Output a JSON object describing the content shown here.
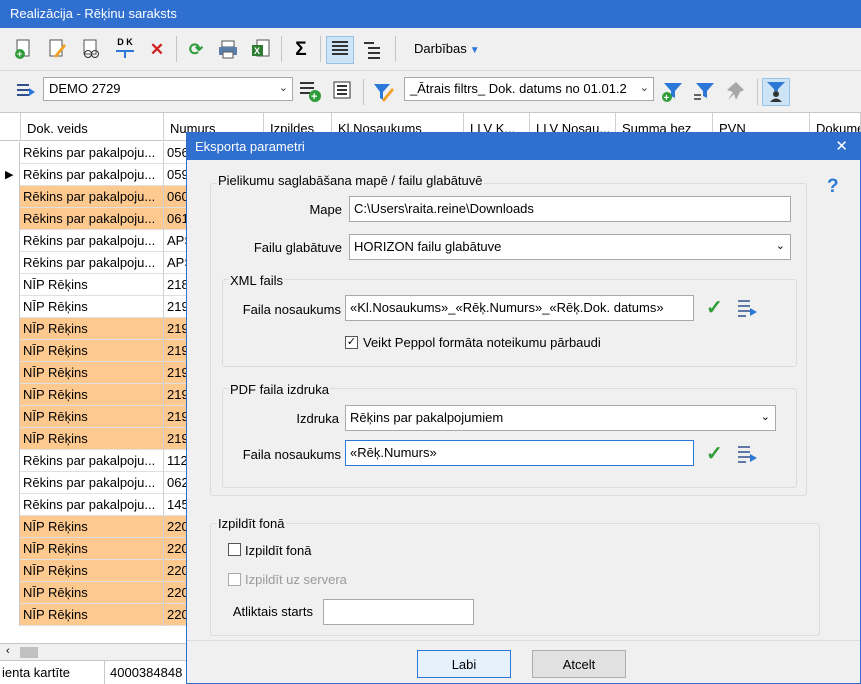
{
  "window": {
    "title": "Realizācija - Rēķinu saraksts"
  },
  "toolbar": {
    "icons": [
      "add-document-icon",
      "edit-document-icon",
      "view-icon",
      "dk-icon",
      "delete-icon",
      "refresh-icon",
      "print-icon",
      "excel-icon",
      "sum-icon",
      "list-view-icon",
      "tree-view-icon"
    ],
    "dk_label": "D K",
    "sum_label": "Σ",
    "actions_label": "Darbības"
  },
  "filterbar": {
    "company_value": "DEMO 2729",
    "filter_value": "_Ātrais filtrs_ Dok. datums no 01.01.2"
  },
  "grid": {
    "columns": [
      "Dok. veids",
      "Numurs",
      "Izpildes",
      "Kl.Nosaukums",
      "LLV K...",
      "LLV Nosau...",
      "Summa bez",
      "PVN",
      "Dokume"
    ],
    "rows": [
      {
        "doc_type": "Rēkins par pakalpoju...",
        "num": "056",
        "highlight": false,
        "marker": ""
      },
      {
        "doc_type": "Rēkins par pakalpoju...",
        "num": "059",
        "highlight": false,
        "marker": "▶"
      },
      {
        "doc_type": "Rēkins par pakalpoju...",
        "num": "060",
        "highlight": true,
        "marker": ""
      },
      {
        "doc_type": "Rēkins par pakalpoju...",
        "num": "061",
        "highlight": true,
        "marker": ""
      },
      {
        "doc_type": "Rēkins par pakalpoju...",
        "num": "APS",
        "highlight": false,
        "marker": ""
      },
      {
        "doc_type": "Rēkins par pakalpoju...",
        "num": "APS",
        "highlight": false,
        "marker": ""
      },
      {
        "doc_type": "NĪP Rēķins",
        "num": "218",
        "highlight": false,
        "marker": ""
      },
      {
        "doc_type": "NĪP Rēķins",
        "num": "219",
        "highlight": false,
        "marker": ""
      },
      {
        "doc_type": "NĪP Rēķins",
        "num": "219",
        "highlight": true,
        "marker": ""
      },
      {
        "doc_type": "NĪP Rēķins",
        "num": "219",
        "highlight": true,
        "marker": ""
      },
      {
        "doc_type": "NĪP Rēķins",
        "num": "219",
        "highlight": true,
        "marker": ""
      },
      {
        "doc_type": "NĪP Rēķins",
        "num": "219",
        "highlight": true,
        "marker": ""
      },
      {
        "doc_type": "NĪP Rēķins",
        "num": "219",
        "highlight": true,
        "marker": ""
      },
      {
        "doc_type": "NĪP Rēķins",
        "num": "219",
        "highlight": true,
        "marker": ""
      },
      {
        "doc_type": "Rēkins par pakalpoju...",
        "num": "112",
        "highlight": false,
        "marker": ""
      },
      {
        "doc_type": "Rēkins par pakalpoju...",
        "num": "062",
        "highlight": false,
        "marker": ""
      },
      {
        "doc_type": "Rēkins par pakalpoju...",
        "num": "145",
        "highlight": false,
        "marker": ""
      },
      {
        "doc_type": "NĪP Rēķins",
        "num": "220",
        "highlight": true,
        "marker": ""
      },
      {
        "doc_type": "NĪP Rēķins",
        "num": "220",
        "highlight": true,
        "marker": ""
      },
      {
        "doc_type": "NĪP Rēķins",
        "num": "220",
        "highlight": true,
        "marker": ""
      },
      {
        "doc_type": "NĪP Rēķins",
        "num": "220",
        "highlight": true,
        "marker": ""
      },
      {
        "doc_type": "NĪP Rēķins",
        "num": "220",
        "highlight": true,
        "marker": ""
      }
    ]
  },
  "statusbar": {
    "label": "ienta kartīte",
    "value": "4000384848"
  },
  "dialog": {
    "title": "Eksporta parametri",
    "help": "?",
    "close": "✕",
    "section_storage": {
      "legend": "Pielikumu saglabāšana mapē / failu glabātuvē",
      "folder_label": "Mape",
      "folder_value": "C:\\Users\\raita.reine\\Downloads",
      "storage_label": "Failu glabātuve",
      "storage_value": "HORIZON failu glabātuve"
    },
    "section_xml": {
      "legend": "XML fails",
      "filename_label": "Faila nosaukums",
      "filename_value": "«Kl.Nosaukums»_«Rēķ.Numurs»_«Rēķ.Dok. datums»",
      "peppol_label": "Veikt Peppol formāta noteikumu pārbaudi",
      "peppol_checked": true
    },
    "section_pdf": {
      "legend": "PDF faila izdruka",
      "print_label": "Izdruka",
      "print_value": "Rēķins par pakalpojumiem",
      "filename_label": "Faila nosaukums",
      "filename_value": "«Rēķ.Numurs»"
    },
    "section_background": {
      "legend": "Izpildīt fonā",
      "bg_label": "Izpildīt fonā",
      "bg_checked": false,
      "server_label": "Izpildīt uz servera",
      "server_checked": false,
      "delayed_label": "Atliktais starts",
      "delayed_value": ""
    },
    "ok_label": "Labi",
    "cancel_label": "Atcelt"
  },
  "colors": {
    "titlebar": "#2f6fd0",
    "row_highlight": "#fdc98f",
    "accent": "#2b78d8",
    "ok_check": "#2e9d3a"
  }
}
